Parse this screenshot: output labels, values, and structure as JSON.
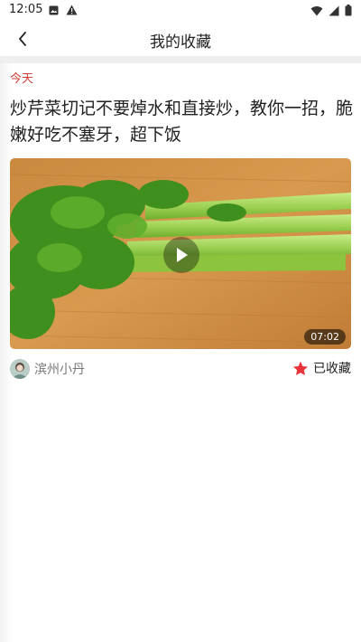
{
  "status_bar": {
    "time": "12:05",
    "left_icons": [
      "notification-image-icon",
      "alert-icon"
    ],
    "right_icons": [
      "wifi-icon",
      "signal-icon",
      "battery-icon"
    ]
  },
  "nav": {
    "back_icon": "chevron-left-icon",
    "title": "我的收藏"
  },
  "list": {
    "section_label": "今天",
    "items": [
      {
        "title": "炒芹菜切记不要焯水和直接炒，教你一招，脆嫩好吃不塞牙，超下饭",
        "duration": "07:02",
        "author": "滨州小丹",
        "favorite_label": "已收藏",
        "favorite_icon": "star-icon",
        "favorite_color": "#e8333a"
      }
    ]
  },
  "colors": {
    "accent": "#d43c33",
    "divider": "#efefef"
  }
}
